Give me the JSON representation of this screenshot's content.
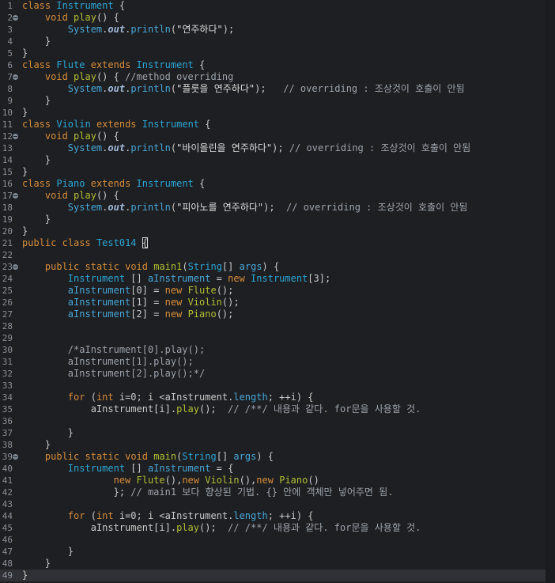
{
  "editor": {
    "lines": [
      {
        "n": "1",
        "fold": false,
        "seg": [
          [
            "kw",
            "class"
          ],
          [
            "t",
            " "
          ],
          [
            "type",
            "Instrument"
          ],
          [
            "t",
            " {"
          ]
        ]
      },
      {
        "n": "2",
        "fold": true,
        "seg": [
          [
            "t",
            "    "
          ],
          [
            "kw",
            "void"
          ],
          [
            "t",
            " "
          ],
          [
            "fn",
            "play"
          ],
          [
            "t",
            "() {"
          ]
        ]
      },
      {
        "n": "3",
        "fold": false,
        "seg": [
          [
            "t",
            "        "
          ],
          [
            "ff",
            "System"
          ],
          [
            "t",
            "."
          ],
          [
            "it",
            "out"
          ],
          [
            "t",
            "."
          ],
          [
            "ff",
            "println"
          ],
          [
            "t",
            "("
          ],
          [
            "str",
            "\"연주하다\""
          ],
          [
            "t",
            ");"
          ]
        ]
      },
      {
        "n": "4",
        "fold": false,
        "seg": [
          [
            "t",
            "    }"
          ]
        ]
      },
      {
        "n": "5",
        "fold": false,
        "seg": [
          [
            "t",
            "}"
          ]
        ]
      },
      {
        "n": "6",
        "fold": false,
        "seg": [
          [
            "kw",
            "class"
          ],
          [
            "t",
            " "
          ],
          [
            "type",
            "Flute"
          ],
          [
            "t",
            " "
          ],
          [
            "kw",
            "extends"
          ],
          [
            "t",
            " "
          ],
          [
            "type",
            "Instrument"
          ],
          [
            "t",
            " {"
          ]
        ]
      },
      {
        "n": "7",
        "fold": true,
        "seg": [
          [
            "t",
            "    "
          ],
          [
            "kw",
            "void"
          ],
          [
            "t",
            " "
          ],
          [
            "fn",
            "play"
          ],
          [
            "t",
            "() { "
          ],
          [
            "cmt",
            "//method overriding"
          ]
        ]
      },
      {
        "n": "8",
        "fold": false,
        "seg": [
          [
            "t",
            "        "
          ],
          [
            "ff",
            "System"
          ],
          [
            "t",
            "."
          ],
          [
            "it",
            "out"
          ],
          [
            "t",
            "."
          ],
          [
            "ff",
            "println"
          ],
          [
            "t",
            "("
          ],
          [
            "str",
            "\"플룻을 연주하다\""
          ],
          [
            "t",
            ");   "
          ],
          [
            "cmt",
            "// overriding : 조상것이 호출이 안됨"
          ]
        ]
      },
      {
        "n": "9",
        "fold": false,
        "seg": [
          [
            "t",
            "    }"
          ]
        ]
      },
      {
        "n": "10",
        "fold": false,
        "seg": [
          [
            "t",
            "}"
          ]
        ]
      },
      {
        "n": "11",
        "fold": false,
        "seg": [
          [
            "kw",
            "class"
          ],
          [
            "t",
            " "
          ],
          [
            "type",
            "Violin"
          ],
          [
            "t",
            " "
          ],
          [
            "kw",
            "extends"
          ],
          [
            "t",
            " "
          ],
          [
            "type",
            "Instrument"
          ],
          [
            "t",
            " {"
          ]
        ]
      },
      {
        "n": "12",
        "fold": true,
        "seg": [
          [
            "t",
            "    "
          ],
          [
            "kw",
            "void"
          ],
          [
            "t",
            " "
          ],
          [
            "fn",
            "play"
          ],
          [
            "t",
            "() {"
          ]
        ]
      },
      {
        "n": "13",
        "fold": false,
        "seg": [
          [
            "t",
            "        "
          ],
          [
            "ff",
            "System"
          ],
          [
            "t",
            "."
          ],
          [
            "it",
            "out"
          ],
          [
            "t",
            "."
          ],
          [
            "ff",
            "println"
          ],
          [
            "t",
            "("
          ],
          [
            "str",
            "\"바이올린을 연주하다\""
          ],
          [
            "t",
            "); "
          ],
          [
            "cmt",
            "// overriding : 조상것이 호출이 안됨"
          ]
        ]
      },
      {
        "n": "14",
        "fold": false,
        "seg": [
          [
            "t",
            "    }"
          ]
        ]
      },
      {
        "n": "15",
        "fold": false,
        "seg": [
          [
            "t",
            "}"
          ]
        ]
      },
      {
        "n": "16",
        "fold": false,
        "seg": [
          [
            "kw",
            "class"
          ],
          [
            "t",
            " "
          ],
          [
            "type",
            "Piano"
          ],
          [
            "t",
            " "
          ],
          [
            "kw",
            "extends"
          ],
          [
            "t",
            " "
          ],
          [
            "type",
            "Instrument"
          ],
          [
            "t",
            " {"
          ]
        ]
      },
      {
        "n": "17",
        "fold": true,
        "seg": [
          [
            "t",
            "    "
          ],
          [
            "kw",
            "void"
          ],
          [
            "t",
            " "
          ],
          [
            "fn",
            "play"
          ],
          [
            "t",
            "() {"
          ]
        ]
      },
      {
        "n": "18",
        "fold": false,
        "seg": [
          [
            "t",
            "        "
          ],
          [
            "ff",
            "System"
          ],
          [
            "t",
            "."
          ],
          [
            "it",
            "out"
          ],
          [
            "t",
            "."
          ],
          [
            "ff",
            "println"
          ],
          [
            "t",
            "("
          ],
          [
            "str",
            "\"피아노를 연주하다\""
          ],
          [
            "t",
            ");  "
          ],
          [
            "cmt",
            "// overriding : 조상것이 호출이 안됨"
          ]
        ]
      },
      {
        "n": "19",
        "fold": false,
        "seg": [
          [
            "t",
            "    }"
          ]
        ]
      },
      {
        "n": "20",
        "fold": false,
        "seg": [
          [
            "t",
            "}"
          ]
        ]
      },
      {
        "n": "21",
        "fold": false,
        "seg": [
          [
            "kw",
            "public"
          ],
          [
            "t",
            " "
          ],
          [
            "kw",
            "class"
          ],
          [
            "t",
            " "
          ],
          [
            "type",
            "Test014"
          ],
          [
            "t",
            " "
          ],
          [
            "hl",
            "{"
          ]
        ]
      },
      {
        "n": "22",
        "fold": false,
        "seg": [
          [
            "t",
            ""
          ]
        ]
      },
      {
        "n": "23",
        "fold": true,
        "seg": [
          [
            "t",
            "    "
          ],
          [
            "kw",
            "public"
          ],
          [
            "t",
            " "
          ],
          [
            "kw",
            "static"
          ],
          [
            "t",
            " "
          ],
          [
            "kw",
            "void"
          ],
          [
            "t",
            " "
          ],
          [
            "fn",
            "main1"
          ],
          [
            "t",
            "("
          ],
          [
            "type",
            "String"
          ],
          [
            "t",
            "[] "
          ],
          [
            "ff",
            "args"
          ],
          [
            "t",
            ") {"
          ]
        ]
      },
      {
        "n": "24",
        "fold": false,
        "seg": [
          [
            "t",
            "        "
          ],
          [
            "type",
            "Instrument"
          ],
          [
            "t",
            " [] "
          ],
          [
            "ff",
            "aInstrument"
          ],
          [
            "t",
            " = "
          ],
          [
            "kw",
            "new"
          ],
          [
            "t",
            " "
          ],
          [
            "type",
            "Instrument"
          ],
          [
            "t",
            "[3];"
          ]
        ]
      },
      {
        "n": "25",
        "fold": false,
        "seg": [
          [
            "t",
            "        "
          ],
          [
            "ff",
            "aInstrument"
          ],
          [
            "t",
            "[0] = "
          ],
          [
            "kw",
            "new"
          ],
          [
            "t",
            " "
          ],
          [
            "fn",
            "Flute"
          ],
          [
            "t",
            "();"
          ]
        ]
      },
      {
        "n": "26",
        "fold": false,
        "seg": [
          [
            "t",
            "        "
          ],
          [
            "ff",
            "aInstrument"
          ],
          [
            "t",
            "[1] = "
          ],
          [
            "kw",
            "new"
          ],
          [
            "t",
            " "
          ],
          [
            "fn",
            "Violin"
          ],
          [
            "t",
            "();"
          ]
        ]
      },
      {
        "n": "27",
        "fold": false,
        "seg": [
          [
            "t",
            "        "
          ],
          [
            "ff",
            "aInstrument"
          ],
          [
            "t",
            "[2] = "
          ],
          [
            "kw",
            "new"
          ],
          [
            "t",
            " "
          ],
          [
            "fn",
            "Piano"
          ],
          [
            "t",
            "();"
          ]
        ]
      },
      {
        "n": "28",
        "fold": false,
        "seg": [
          [
            "t",
            ""
          ]
        ]
      },
      {
        "n": "29",
        "fold": false,
        "seg": [
          [
            "t",
            ""
          ]
        ]
      },
      {
        "n": "30",
        "fold": false,
        "seg": [
          [
            "t",
            "        "
          ],
          [
            "cmt",
            "/*aInstrument[0].play();"
          ]
        ]
      },
      {
        "n": "31",
        "fold": false,
        "seg": [
          [
            "t",
            "        "
          ],
          [
            "cmt",
            "aInstrument[1].play();"
          ]
        ]
      },
      {
        "n": "32",
        "fold": false,
        "seg": [
          [
            "t",
            "        "
          ],
          [
            "cmt",
            "aInstrument[2].play();*/"
          ]
        ]
      },
      {
        "n": "33",
        "fold": false,
        "seg": [
          [
            "t",
            ""
          ]
        ]
      },
      {
        "n": "34",
        "fold": false,
        "seg": [
          [
            "t",
            "        "
          ],
          [
            "kw",
            "for"
          ],
          [
            "t",
            " ("
          ],
          [
            "kw",
            "int"
          ],
          [
            "t",
            " i=0; i <aInstrument."
          ],
          [
            "ff",
            "length"
          ],
          [
            "t",
            "; ++i) {"
          ]
        ]
      },
      {
        "n": "35",
        "fold": false,
        "seg": [
          [
            "t",
            "            aInstrument[i]."
          ],
          [
            "fn",
            "play"
          ],
          [
            "t",
            "();  "
          ],
          [
            "cmt",
            "// /**/ 내용과 같다. for문을 사용할 것."
          ]
        ]
      },
      {
        "n": "36",
        "fold": false,
        "seg": [
          [
            "t",
            ""
          ]
        ]
      },
      {
        "n": "37",
        "fold": false,
        "seg": [
          [
            "t",
            "        }"
          ]
        ]
      },
      {
        "n": "38",
        "fold": false,
        "seg": [
          [
            "t",
            "    }"
          ]
        ]
      },
      {
        "n": "39",
        "fold": true,
        "seg": [
          [
            "t",
            "    "
          ],
          [
            "kw",
            "public"
          ],
          [
            "t",
            " "
          ],
          [
            "kw",
            "static"
          ],
          [
            "t",
            " "
          ],
          [
            "kw",
            "void"
          ],
          [
            "t",
            " "
          ],
          [
            "fn",
            "main"
          ],
          [
            "t",
            "("
          ],
          [
            "type",
            "String"
          ],
          [
            "t",
            "[] "
          ],
          [
            "ff",
            "args"
          ],
          [
            "t",
            ") {"
          ]
        ]
      },
      {
        "n": "40",
        "fold": false,
        "seg": [
          [
            "t",
            "        "
          ],
          [
            "type",
            "Instrument"
          ],
          [
            "t",
            " [] "
          ],
          [
            "ff",
            "aInstrument"
          ],
          [
            "t",
            " = {"
          ]
        ]
      },
      {
        "n": "41",
        "fold": false,
        "seg": [
          [
            "t",
            "                "
          ],
          [
            "kw",
            "new"
          ],
          [
            "t",
            " "
          ],
          [
            "fn",
            "Flute"
          ],
          [
            "t",
            "(),"
          ],
          [
            "kw",
            "new"
          ],
          [
            "t",
            " "
          ],
          [
            "fn",
            "Violin"
          ],
          [
            "t",
            "(),"
          ],
          [
            "kw",
            "new"
          ],
          [
            "t",
            " "
          ],
          [
            "fn",
            "Piano"
          ],
          [
            "t",
            "()"
          ]
        ]
      },
      {
        "n": "42",
        "fold": false,
        "seg": [
          [
            "t",
            "                }; "
          ],
          [
            "cmt",
            "// main1 보다 향상된 기법. {} 안에 객체만 넣어주면 됨."
          ]
        ]
      },
      {
        "n": "43",
        "fold": false,
        "seg": [
          [
            "t",
            ""
          ]
        ]
      },
      {
        "n": "44",
        "fold": false,
        "seg": [
          [
            "t",
            "        "
          ],
          [
            "kw",
            "for"
          ],
          [
            "t",
            " ("
          ],
          [
            "kw",
            "int"
          ],
          [
            "t",
            " i=0; i <aInstrument."
          ],
          [
            "ff",
            "length"
          ],
          [
            "t",
            "; ++i) {"
          ]
        ]
      },
      {
        "n": "45",
        "fold": false,
        "seg": [
          [
            "t",
            "            aInstrument[i]."
          ],
          [
            "fn",
            "play"
          ],
          [
            "t",
            "();  "
          ],
          [
            "cmt",
            "// /**/ 내용과 같다. for문을 사용할 것."
          ]
        ]
      },
      {
        "n": "46",
        "fold": false,
        "seg": [
          [
            "t",
            ""
          ]
        ]
      },
      {
        "n": "47",
        "fold": false,
        "seg": [
          [
            "t",
            "        }"
          ]
        ]
      },
      {
        "n": "48",
        "fold": false,
        "seg": [
          [
            "t",
            "    }"
          ]
        ]
      },
      {
        "n": "49",
        "fold": false,
        "current": true,
        "seg": [
          [
            "t",
            "}"
          ]
        ]
      }
    ]
  },
  "colors": {
    "background": "#1e1f22",
    "keyword": "#d68d3a",
    "type": "#2ba6d6",
    "function": "#b2bf33",
    "field": "#47a7d8",
    "comment": "#9ca3ad",
    "line_number": "#8a8f98"
  },
  "icons": {
    "fold_marker": "collapse-icon"
  }
}
